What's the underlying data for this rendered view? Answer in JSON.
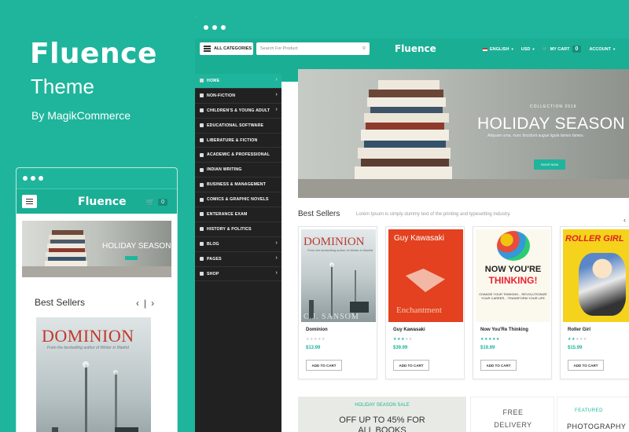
{
  "brand": {
    "title": "Fluence",
    "subtitle": "Theme",
    "by": "By MagikCommerce"
  },
  "mobile": {
    "logo": "Fluence",
    "cart_count": "0",
    "banner_title": "HOLIDAY SEASON",
    "best_sellers": "Best Sellers",
    "prev_arrow": "‹",
    "next_arrow": "›",
    "book_title": "DOMINION",
    "book_subtitle": "From the bestselling author of Winter in Madrid"
  },
  "desktop": {
    "all_categories": "ALL CATEGORIES",
    "search_placeholder": "Search For Product",
    "logo": "Fluence",
    "language": "ENGLISH",
    "currency": "USD",
    "my_cart": "MY CART",
    "cart_count": "0",
    "account": "ACCOUNT",
    "sidebar": [
      {
        "label": "HOME",
        "active": true,
        "arrow": true
      },
      {
        "label": "NON-FICTION",
        "active": false,
        "arrow": true
      },
      {
        "label": "CHILDREN'S & YOUNG ADULT",
        "active": false,
        "arrow": true
      },
      {
        "label": "EDUCATIONAL SOFTWARE",
        "active": false,
        "arrow": false
      },
      {
        "label": "LIBERATURE & FICTION",
        "active": false,
        "arrow": false
      },
      {
        "label": "ACADEMIC & PROFESSIONAL",
        "active": false,
        "arrow": false
      },
      {
        "label": "INDIAN WRITING",
        "active": false,
        "arrow": false
      },
      {
        "label": "BUSINESS & MANAGEMENT",
        "active": false,
        "arrow": false
      },
      {
        "label": "COMICS & GRAPHIC NOVELS",
        "active": false,
        "arrow": false
      },
      {
        "label": "ENTERANCE EXAM",
        "active": false,
        "arrow": false
      },
      {
        "label": "HISTORY & POLITICS",
        "active": false,
        "arrow": false
      },
      {
        "label": "BLOG",
        "active": false,
        "arrow": true
      },
      {
        "label": "PAGES",
        "active": false,
        "arrow": true
      },
      {
        "label": "SHOP",
        "active": false,
        "arrow": true
      }
    ],
    "hero": {
      "collection": "COLLECTION 2019",
      "title": "HOLIDAY SEASON",
      "description": "Aliquam urna, nunc tincidunt augue ligula fames fames.",
      "button": "SHOP NOW"
    },
    "best_sellers": "Best Sellers",
    "best_sellers_desc": "Lorem Ipsum is simply dummy text of the printing and typesetting industry.",
    "arrow": "‹",
    "products": [
      {
        "name": "Dominion",
        "price": "$13.99",
        "button": "ADD TO CART",
        "stars_filled": "",
        "stars_empty": "★★★★★",
        "rating": 0,
        "cover_title": "DOMINION",
        "cover_sub": "From the bestselling author of Winter in Madrid",
        "cover_author": "C.J. SANSOM"
      },
      {
        "name": "Guy Kawasaki",
        "price": "$39.99",
        "button": "ADD TO CART",
        "stars_filled": "★★★",
        "stars_empty": "★★",
        "rating": 3,
        "cover_title": "Guy Kawasaki",
        "cover_bottom": "Enchantment"
      },
      {
        "name": "Now You'Re Thinking",
        "price": "$19.99",
        "button": "ADD TO CART",
        "stars_filled": "★★★★★",
        "stars_empty": "",
        "rating": 5,
        "cover_title1": "NOW YOU'RE",
        "cover_title2": "THINKING!",
        "cover_sub": "CHANGE YOUR THINKING... REVOLUTIONIZE YOUR CAREER... TRANSFORM YOUR LIFE"
      },
      {
        "name": "Roller Girl",
        "price": "$15.99",
        "button": "ADD TO CART",
        "stars_filled": "★★",
        "stars_empty": "★★★",
        "rating": 2,
        "cover_title": "ROLLER GIRL"
      }
    ],
    "bottom": {
      "sale_tag": "HOLIDAY SEASON SALE",
      "sale_line1": "OFF UP TO 45% FOR",
      "sale_line2": "ALL BOOKS",
      "free1": "FREE",
      "free2": "DELIVERY",
      "featured": "FEATURED",
      "photography": "PHOTOGRAPHY"
    }
  },
  "colors": {
    "accent": "#1eb59c",
    "sidebar_bg": "#212121"
  }
}
